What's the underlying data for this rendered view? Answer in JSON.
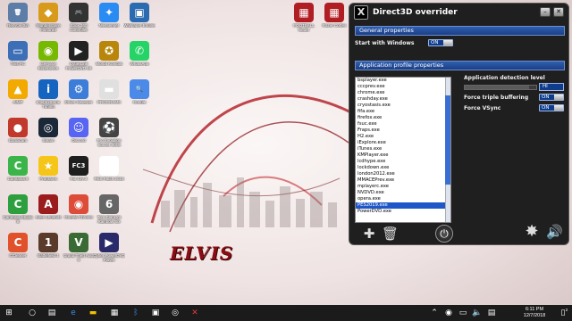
{
  "wallpaper": {
    "text": "ELVIS"
  },
  "desktop": {
    "icons": [
      {
        "label": "Recycle Bin",
        "glyph": "🗑",
        "color": "#5b7da8"
      },
      {
        "label": "Wondershare Filmora9",
        "glyph": "◆",
        "color": "#d89a1a"
      },
      {
        "label": "Xbox 360 Controller",
        "glyph": "🎮",
        "color": "#333333"
      },
      {
        "label": "Messenger",
        "glyph": "✦",
        "color": "#2a8bf2"
      },
      {
        "label": "Wallpaper Engine",
        "glyph": "▣",
        "color": "#2b6cb0"
      },
      {
        "label": "This PC",
        "glyph": "▭",
        "color": "#3d6fb6"
      },
      {
        "label": "GeForce Experience",
        "glyph": "◉",
        "color": "#76b900"
      },
      {
        "label": "CyberLink PowerDVD 18",
        "glyph": "▶",
        "color": "#222222"
      },
      {
        "label": "Mortal Kombat",
        "glyph": "✪",
        "color": "#b8860b"
      },
      {
        "label": "WhatsApp",
        "glyph": "✆",
        "color": "#25d366"
      },
      {
        "label": "AIMP",
        "glyph": "▲",
        "color": "#f2a900"
      },
      {
        "label": "Intel Extreme Tuning",
        "glyph": "i",
        "color": "#1565c0"
      },
      {
        "label": "Driver Sweeper",
        "glyph": "⚙",
        "color": "#3c7dd9"
      },
      {
        "label": "PROGRAMS",
        "glyph": "▬",
        "color": "#e0e0e0"
      },
      {
        "label": "Google",
        "glyph": "🔍",
        "color": "#4b8ae8"
      },
      {
        "label": "Bandicam",
        "glyph": "●",
        "color": "#c0392b"
      },
      {
        "label": "Steam",
        "glyph": "◎",
        "color": "#1b2838"
      },
      {
        "label": "Discord",
        "glyph": "☺",
        "color": "#5865f2"
      },
      {
        "label": "Pro Evolution Soccer 2019",
        "glyph": "⚽",
        "color": "#444444"
      },
      {
        "label": "Camtasia 9",
        "glyph": "C",
        "color": "#3bb54a"
      },
      {
        "label": "Programs",
        "glyph": "★",
        "color": "#f5c518"
      },
      {
        "label": "Far Cry 3",
        "glyph": "FC3",
        "color": "#1e1e1e"
      },
      {
        "label": "PES Patch 2019",
        "glyph": "P",
        "color": "#ffffff"
      },
      {
        "label": "Camtasia Studio 8",
        "glyph": "C",
        "color": "#2e9f3e"
      },
      {
        "label": "Apex Legends",
        "glyph": "A",
        "color": "#9b1c1c"
      },
      {
        "label": "Google Chrome",
        "glyph": "◉",
        "color": "#dd4b39"
      },
      {
        "label": "Tom Clancy's Rainbow Six",
        "glyph": "6",
        "color": "#666666"
      },
      {
        "label": "CCleaner",
        "glyph": "C",
        "color": "#e0522b"
      },
      {
        "label": "Battlefield 1",
        "glyph": "1",
        "color": "#5a3a2a"
      },
      {
        "label": "Grand Theft Auto V",
        "glyph": "V",
        "color": "#3a6b35"
      },
      {
        "label": "Cyber PowerDVD Player",
        "glyph": "▶",
        "color": "#2a2a6a"
      }
    ],
    "right_icons": [
      {
        "label": "FOOTBALL Neuer",
        "glyph": "▦",
        "color": "#b01e23"
      },
      {
        "label": "Razer Cortex",
        "glyph": "▦",
        "color": "#b01e23"
      }
    ]
  },
  "d3d": {
    "title": "Direct3D overrider",
    "logo": "X",
    "general_section": "General properties",
    "start_with_windows_label": "Start with Windows",
    "start_with_windows_value": "ON",
    "app_profile_section": "Application profile properties",
    "processes": [
      "bsplayer.exe",
      "cccprev.exe",
      "chrome.exe",
      "crashday.exe",
      "cryostasis.exe",
      "fifa.exe",
      "firefox.exe",
      "fsuc.exe",
      "Fraps.exe",
      "H2.exe",
      "iExplore.exe",
      "iTunes.exe",
      "KMPlayer.exe",
      "lcdhype.exe",
      "lockdown.exe",
      "london2012.exe",
      "MMACEPrev.exe",
      "mplayerc.exe",
      "NVDVD.exe",
      "opera.exe",
      "PES2019.exe",
      "PowerDVD.exe"
    ],
    "selected_process": "PES2019.exe",
    "detection_level_label": "Application detection level",
    "detection_level_value": "HI",
    "detection_level_fill": 0.9,
    "triple_buffering_label": "Force triple buffering",
    "triple_buffering_value": "ON",
    "vsync_label": "Force VSync",
    "vsync_value": "ON",
    "add_icon": "✚",
    "delete_icon": "🗑",
    "power_icon": "⏻",
    "settings_icon": "✸",
    "sound_icon": "🔊"
  },
  "taskbar": {
    "time": "6:11 PM",
    "date": "12/7/2018",
    "notification_count": "2"
  },
  "colors": {
    "accent_blue": "#1f56c8",
    "window_bg": "#1f1f1f",
    "wallpaper_red": "#8a0d12"
  }
}
